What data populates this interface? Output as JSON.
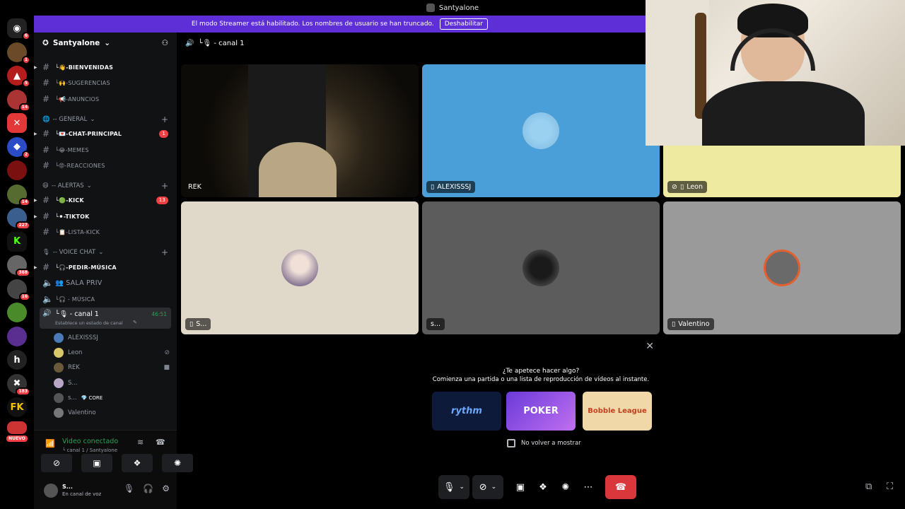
{
  "window": {
    "title": "Santyalone"
  },
  "banner": {
    "text": "El modo Streamer está habilitado. Los nombres de usuario se han truncado.",
    "button": "Deshabilitar"
  },
  "servers": {
    "badges": [
      "6",
      "1",
      "5",
      "14",
      "2",
      "14",
      "227",
      "368",
      "16",
      "183"
    ],
    "nuevo": "NUEVO"
  },
  "guild": {
    "name": "Santyalone"
  },
  "channels": {
    "bienvenidas": "└👋-BIENVENIDAS",
    "sugerencias": "└🙌-SUGERENCIAS",
    "anuncios": "└📢-ANUNCIOS",
    "cat_general": "-- GENERAL",
    "chat_principal": "└💌-CHAT-PRINCIPAL",
    "chat_principal_count": "1",
    "memes": "└😂-MEMES",
    "reacciones": "└😡-REACCIONES",
    "cat_alertas": "-- ALERTAS",
    "kick": "└🟢-KICK",
    "kick_count": "13",
    "tiktok": "└⚫-TIKTOK",
    "lista_kick": "└📋-LISTA-KICK",
    "cat_voice": "-- VOICE CHAT",
    "pedir_musica": "└🎧-PEDIR-MÚSICA",
    "sala_priv": "👥 SALA PRIV",
    "musica": "└🎧 - MÚSICA",
    "canal1": "└🎙 - canal 1",
    "canal1_time": "46:51",
    "canal1_status": "Establece un estado de canal"
  },
  "members": [
    "ALEXISSSJ",
    "Leon",
    "REK",
    "S...",
    "s...",
    "Valentino"
  ],
  "member_tag": "💎 CORE",
  "voice_connection": {
    "status": "Video conectado",
    "channel": "└ canal 1 / Santyalone"
  },
  "user": {
    "name": "S...",
    "status": "En canal de voz"
  },
  "call": {
    "header": "└🎙 - canal 1"
  },
  "tiles": [
    {
      "name": "REK"
    },
    {
      "name": "ALEXISSSJ"
    },
    {
      "name": "Leon"
    },
    {
      "name": "S..."
    },
    {
      "name": "s..."
    },
    {
      "name": "Valentino"
    }
  ],
  "activity": {
    "question": "¿Te apetece hacer algo?",
    "subtitle": "Comienza una partida o una lista de reproducción de vídeos al instante.",
    "cards": [
      "rythm",
      "POKER",
      "Bobble League"
    ],
    "checkbox": "No volver a mostrar"
  },
  "colors": {
    "accent": "#5e2fd6",
    "green": "#23a559",
    "red": "#da373c",
    "sidebar": "#111214"
  }
}
